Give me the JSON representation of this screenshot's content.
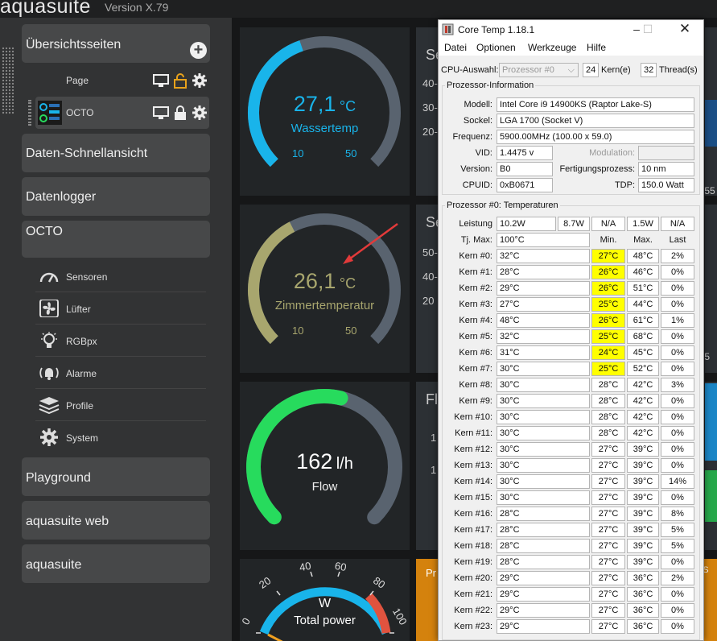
{
  "app": {
    "title": "aquasuite",
    "version": "Version X.79"
  },
  "sidebar": {
    "overview": "Übersichtsseiten",
    "page_label": "Page",
    "octo_page_label": "OCTO",
    "quick_view": "Daten-Schnellansicht",
    "datalogger": "Datenlogger",
    "octo": "OCTO",
    "sub_items": [
      "Sensoren",
      "Lüfter",
      "RGBpx",
      "Alarme",
      "Profile",
      "System"
    ],
    "playground": "Playground",
    "aquasuite_web": "aquasuite web",
    "aquasuite": "aquasuite"
  },
  "dashboard": {
    "water": {
      "value": "27,1",
      "unit": "°C",
      "label": "Wassertemp",
      "min": "10",
      "max": "50",
      "level": 0.43
    },
    "room": {
      "value": "26,1",
      "unit": "°C",
      "label": "Zimmertemperatur",
      "min": "10",
      "max": "50",
      "level": 0.4
    },
    "flow": {
      "value": "162",
      "unit": "l/h",
      "label": "Flow",
      "level": 0.55
    },
    "power": {
      "unit": "W",
      "label": "Total power",
      "ticks": [
        "0",
        "20",
        "40",
        "60",
        "80",
        "100"
      ]
    },
    "cut_texts": {
      "se1": "Se",
      "t40": "40-",
      "t30": "30-",
      "t20": "20-",
      "se2": "Se",
      "t50": "50-",
      "t40b": "40-",
      "t20b": "20",
      "fl": "Fl",
      "one1": "1",
      "one2": "1",
      "pr": "Pr",
      "n55": ":55",
      "n5": ":5",
      "ft": "ft. S"
    },
    "colors": {
      "water": "#19b4ea",
      "room": "#a8a66e",
      "flow": "#27db5d",
      "track": "#59636f"
    }
  },
  "coretemp": {
    "title": "Core Temp 1.18.1",
    "menu": [
      "Datei",
      "Optionen",
      "Werkzeuge",
      "Hilfe"
    ],
    "cpu_select_label": "CPU-Auswahl:",
    "cpu_select_value": "Prozessor #0",
    "cores": "24",
    "cores_label": "Kern(e)",
    "threads": "32",
    "threads_label": "Thread(s)",
    "info_group": "Prozessor-Information",
    "model_label": "Modell:",
    "model": "Intel Core i9 14900KS (Raptor Lake-S)",
    "socket_label": "Sockel:",
    "socket": "LGA 1700 (Socket V)",
    "freq_label": "Frequenz:",
    "freq": "5900.00MHz (100.00 x 59.0)",
    "vid_label": "VID:",
    "vid": "1.4475 v",
    "modulation_label": "Modulation:",
    "version_label": "Version:",
    "version": "B0",
    "process_label": "Fertigungsprozess:",
    "process": "10 nm",
    "cpuid_label": "CPUID:",
    "cpuid": "0xB0671",
    "tdp_label": "TDP:",
    "tdp": "150.0 Watt",
    "temp_group": "Prozessor #0: Temperaturen",
    "power_label": "Leistung",
    "power": [
      "10.2W",
      "8.7W",
      "N/A",
      "1.5W",
      "N/A"
    ],
    "tjmax_label": "Tj. Max:",
    "tjmax": "100°C",
    "col_min": "Min.",
    "col_max": "Max.",
    "col_last": "Last",
    "cores_rows": [
      {
        "name": "Kern #0:",
        "temp": "32°C",
        "min": "27°C",
        "max": "48°C",
        "load": "2%",
        "hl": true
      },
      {
        "name": "Kern #1:",
        "temp": "28°C",
        "min": "26°C",
        "max": "46°C",
        "load": "0%",
        "hl": true
      },
      {
        "name": "Kern #2:",
        "temp": "29°C",
        "min": "26°C",
        "max": "51°C",
        "load": "0%",
        "hl": true
      },
      {
        "name": "Kern #3:",
        "temp": "27°C",
        "min": "25°C",
        "max": "44°C",
        "load": "0%",
        "hl": true
      },
      {
        "name": "Kern #4:",
        "temp": "48°C",
        "min": "26°C",
        "max": "61°C",
        "load": "1%",
        "hl": true
      },
      {
        "name": "Kern #5:",
        "temp": "32°C",
        "min": "25°C",
        "max": "68°C",
        "load": "0%",
        "hl": true
      },
      {
        "name": "Kern #6:",
        "temp": "31°C",
        "min": "24°C",
        "max": "45°C",
        "load": "0%",
        "hl": true
      },
      {
        "name": "Kern #7:",
        "temp": "30°C",
        "min": "25°C",
        "max": "52°C",
        "load": "0%",
        "hl": true
      },
      {
        "name": "Kern #8:",
        "temp": "30°C",
        "min": "28°C",
        "max": "42°C",
        "load": "3%",
        "hl": false
      },
      {
        "name": "Kern #9:",
        "temp": "30°C",
        "min": "28°C",
        "max": "42°C",
        "load": "0%",
        "hl": false
      },
      {
        "name": "Kern #10:",
        "temp": "30°C",
        "min": "28°C",
        "max": "42°C",
        "load": "0%",
        "hl": false
      },
      {
        "name": "Kern #11:",
        "temp": "30°C",
        "min": "28°C",
        "max": "42°C",
        "load": "0%",
        "hl": false
      },
      {
        "name": "Kern #12:",
        "temp": "30°C",
        "min": "27°C",
        "max": "39°C",
        "load": "0%",
        "hl": false
      },
      {
        "name": "Kern #13:",
        "temp": "30°C",
        "min": "27°C",
        "max": "39°C",
        "load": "0%",
        "hl": false
      },
      {
        "name": "Kern #14:",
        "temp": "30°C",
        "min": "27°C",
        "max": "39°C",
        "load": "14%",
        "hl": false
      },
      {
        "name": "Kern #15:",
        "temp": "30°C",
        "min": "27°C",
        "max": "39°C",
        "load": "0%",
        "hl": false
      },
      {
        "name": "Kern #16:",
        "temp": "28°C",
        "min": "27°C",
        "max": "39°C",
        "load": "8%",
        "hl": false
      },
      {
        "name": "Kern #17:",
        "temp": "28°C",
        "min": "27°C",
        "max": "39°C",
        "load": "5%",
        "hl": false
      },
      {
        "name": "Kern #18:",
        "temp": "28°C",
        "min": "27°C",
        "max": "39°C",
        "load": "5%",
        "hl": false
      },
      {
        "name": "Kern #19:",
        "temp": "28°C",
        "min": "27°C",
        "max": "39°C",
        "load": "0%",
        "hl": false
      },
      {
        "name": "Kern #20:",
        "temp": "29°C",
        "min": "27°C",
        "max": "36°C",
        "load": "2%",
        "hl": false
      },
      {
        "name": "Kern #21:",
        "temp": "29°C",
        "min": "27°C",
        "max": "36°C",
        "load": "0%",
        "hl": false
      },
      {
        "name": "Kern #22:",
        "temp": "29°C",
        "min": "27°C",
        "max": "36°C",
        "load": "0%",
        "hl": false
      },
      {
        "name": "Kern #23:",
        "temp": "29°C",
        "min": "27°C",
        "max": "36°C",
        "load": "0%",
        "hl": false
      }
    ]
  }
}
